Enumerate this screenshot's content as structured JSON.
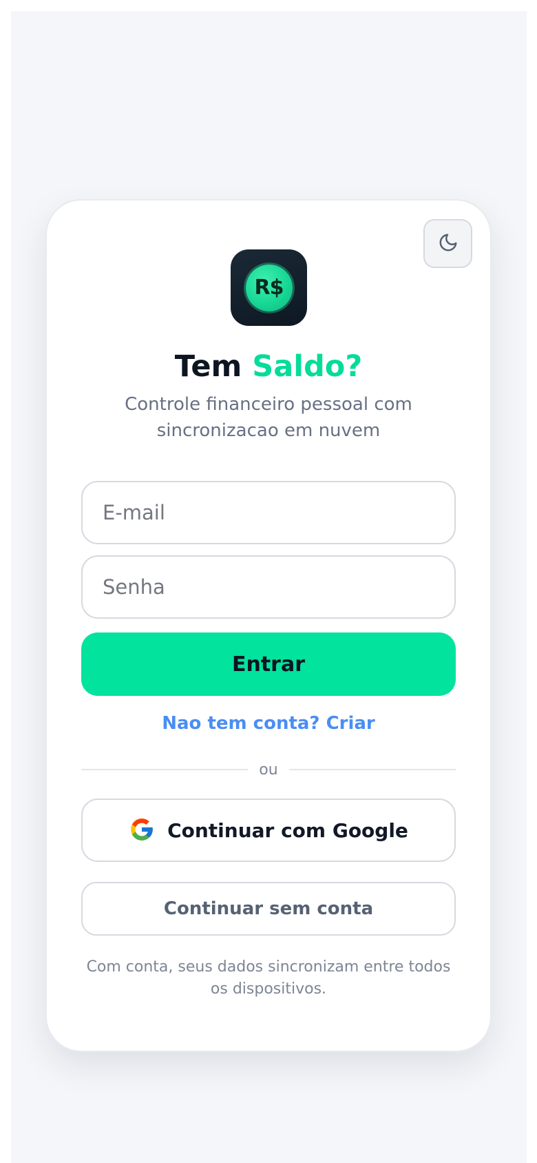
{
  "app": {
    "logo_text": "R$",
    "title_main": "Tem",
    "title_accent": "Saldo?",
    "subtitle": "Controle financeiro pessoal com sincronizacao em nuvem"
  },
  "theme_toggle": {
    "icon": "moon-icon"
  },
  "form": {
    "email_placeholder": "E-mail",
    "email_value": "",
    "password_placeholder": "Senha",
    "password_value": "",
    "submit_label": "Entrar",
    "signup_link": "Nao tem conta? Criar"
  },
  "divider": {
    "label": "ou"
  },
  "alt_login": {
    "google_icon": "google-icon",
    "google_label": "Continuar com Google",
    "guest_label": "Continuar sem conta"
  },
  "footnote": "Com conta, seus dados sincronizam entre todos os dispositivos.",
  "colors": {
    "accent": "#02e39e",
    "link": "#4a8ef3",
    "title": "#0d1521",
    "background": "#f4f6f9"
  }
}
